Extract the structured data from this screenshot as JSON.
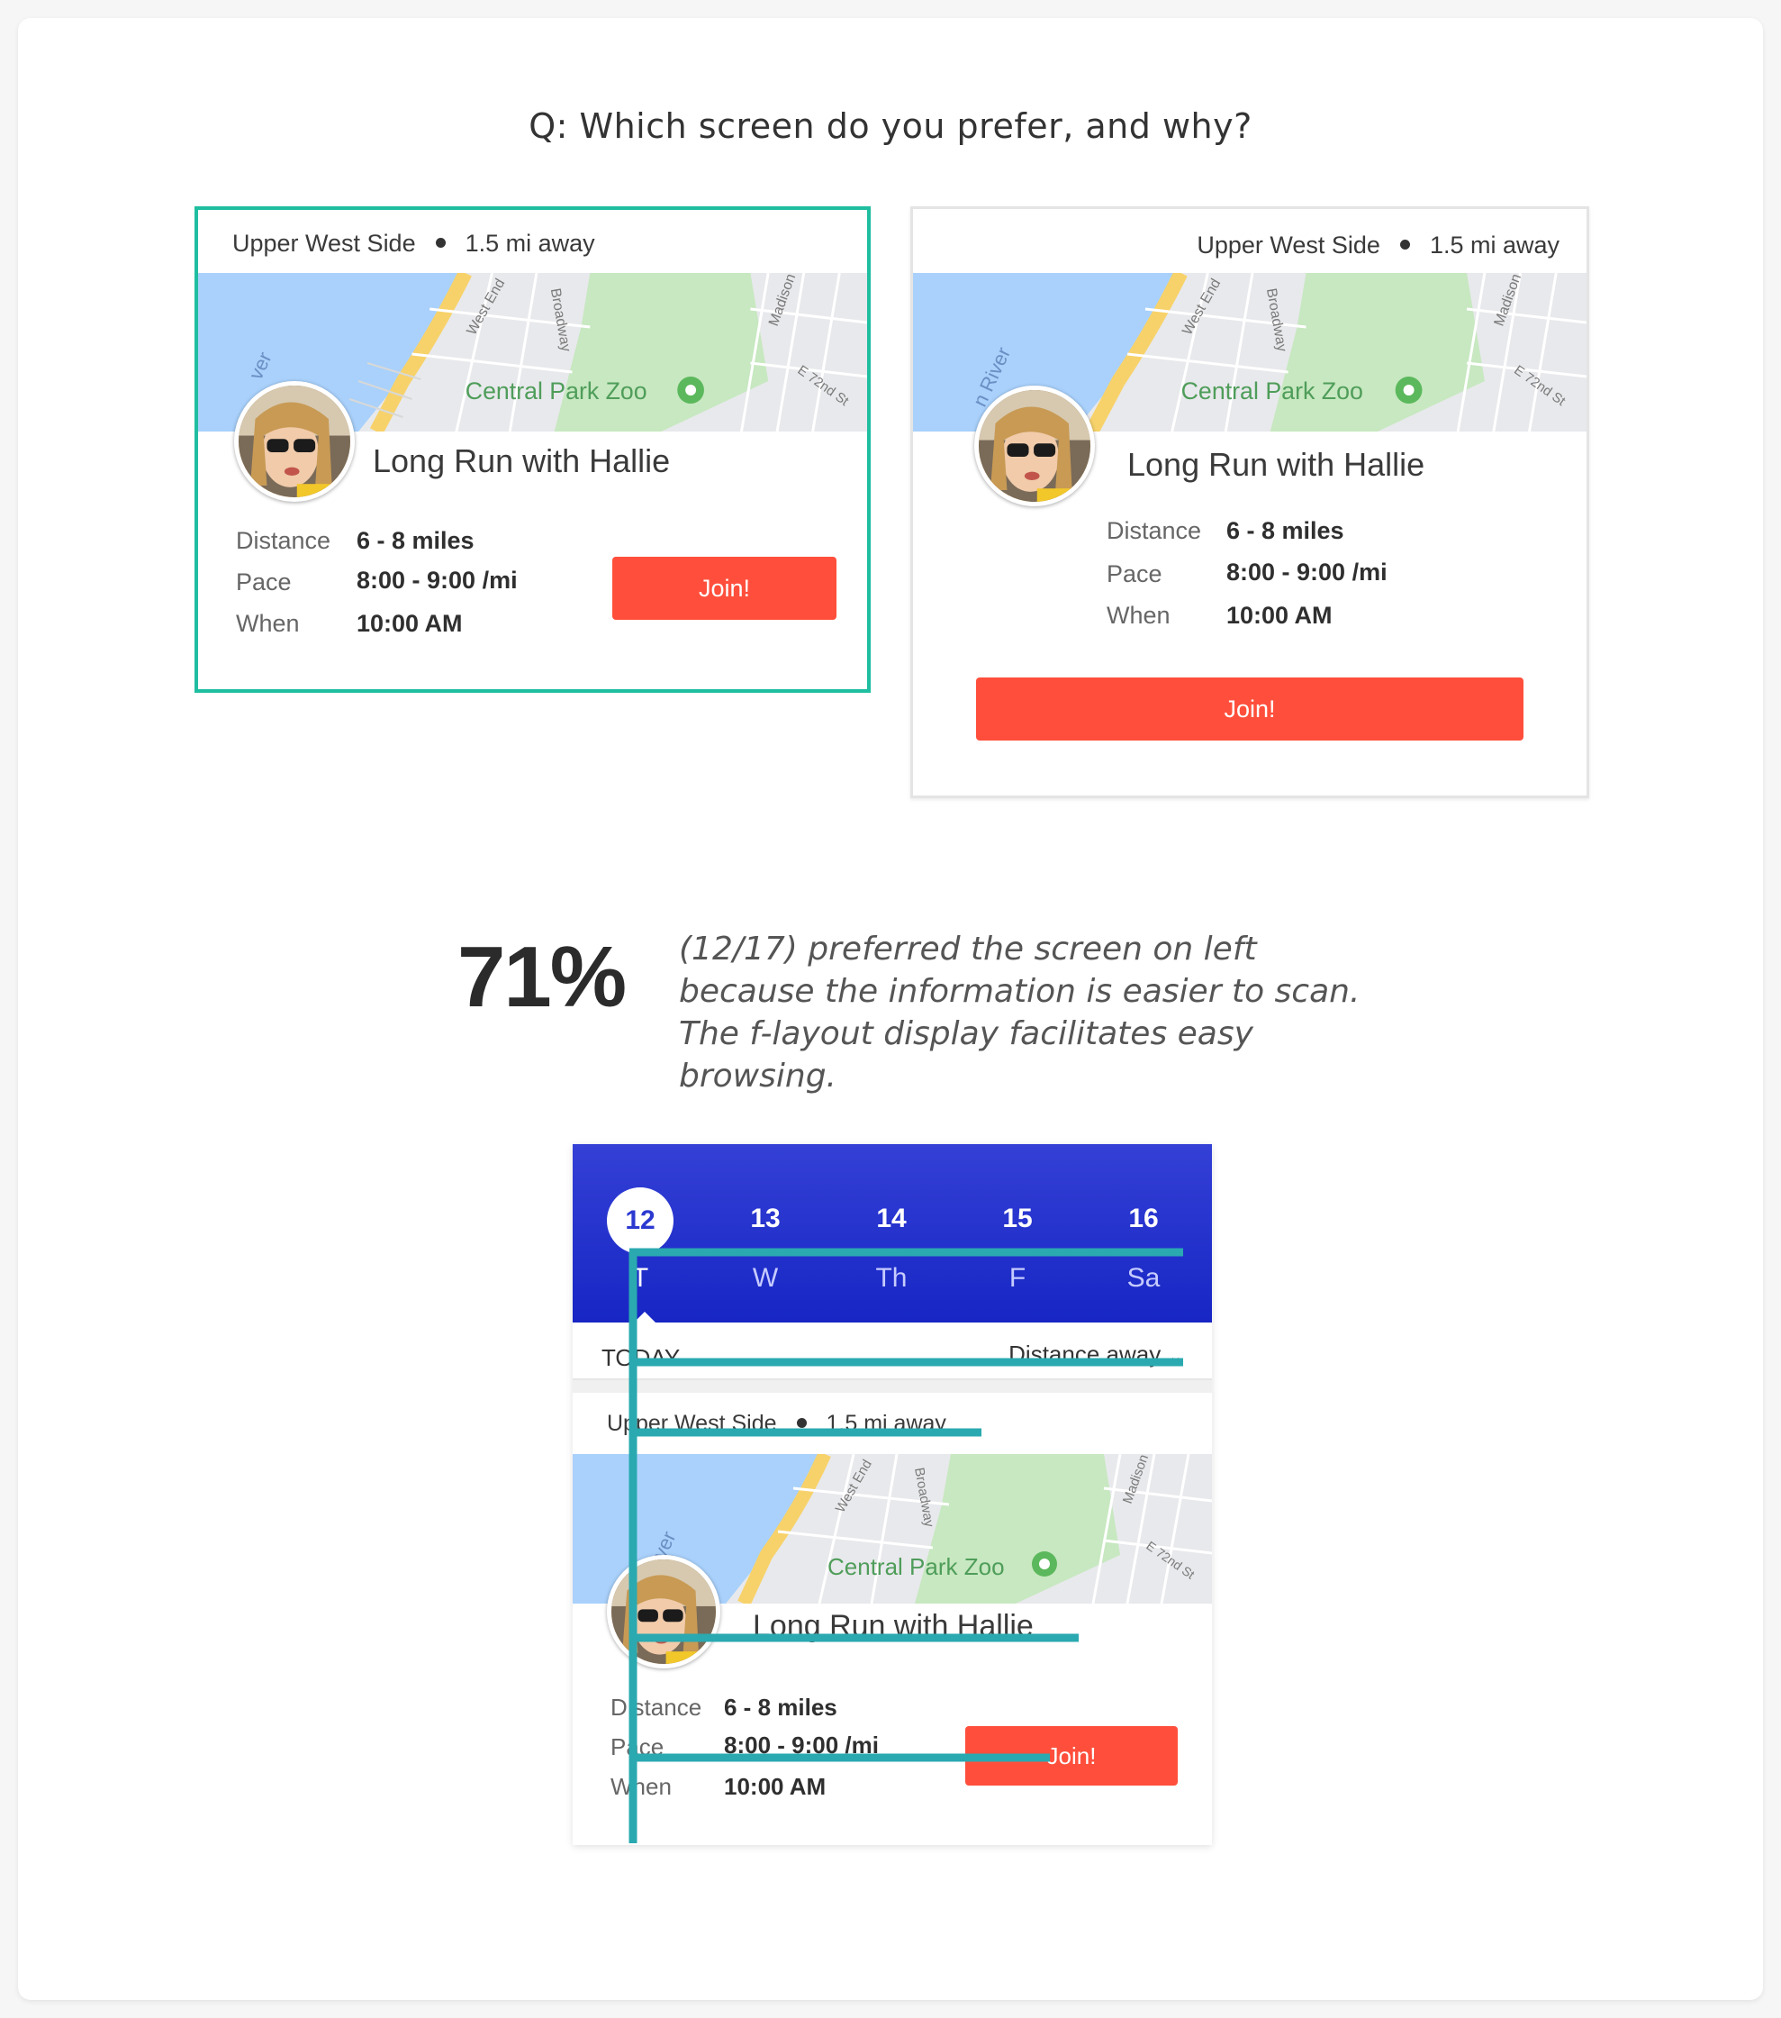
{
  "question": "Q: Which screen do you prefer, and why?",
  "variants": {
    "left": {
      "neighborhood": "Upper West Side",
      "distance_away": "1.5 mi away",
      "map_labels": {
        "park": "Central Park Zoo",
        "street1": "West End",
        "street2": "Broadway",
        "street3": "Madison",
        "street4": "E 72nd St",
        "river": "ver"
      },
      "title": "Long Run with Hallie",
      "details": [
        {
          "label": "Distance",
          "value": "6 - 8 miles"
        },
        {
          "label": "Pace",
          "value": "8:00 - 9:00 /mi"
        },
        {
          "label": "When",
          "value": "10:00 AM"
        }
      ],
      "join_label": "Join!",
      "highlight_color": "#1fbea0"
    },
    "right": {
      "neighborhood": "Upper West Side",
      "distance_away": "1.5 mi away",
      "map_labels": {
        "park": "Central Park Zoo",
        "street1": "West End",
        "street2": "Broadway",
        "street3": "Madison",
        "street4": "E 72nd St",
        "river": "n River"
      },
      "title": "Long Run with Hallie",
      "details": [
        {
          "label": "Distance",
          "value": "6 - 8 miles"
        },
        {
          "label": "Pace",
          "value": "8:00 - 9:00 /mi"
        },
        {
          "label": "When",
          "value": "10:00 AM"
        }
      ],
      "join_label": "Join!"
    }
  },
  "result": {
    "percentage": "71%",
    "explanation": "(12/17) preferred the screen on left because the information is easier to scan. The f-layout display facilitates easy browsing."
  },
  "phone": {
    "days": [
      {
        "num": "12",
        "name": "T",
        "selected": true
      },
      {
        "num": "13",
        "name": "W"
      },
      {
        "num": "14",
        "name": "Th"
      },
      {
        "num": "15",
        "name": "F"
      },
      {
        "num": "16",
        "name": "Sa"
      }
    ],
    "today_label": "TODAY",
    "sort_label": "Distance away",
    "card": {
      "neighborhood": "Upper West Side",
      "distance_away": "1.5 mi away",
      "map_labels": {
        "park": "Central Park Zoo",
        "street1": "West End",
        "street2": "Broadway",
        "street3": "Madison",
        "street4": "E 72nd St",
        "river": "ver"
      },
      "title": "Long Run with Hallie",
      "details": [
        {
          "label": "Distance",
          "value": "6 - 8 miles"
        },
        {
          "label": "Pace",
          "value": "8:00 - 9:00 /mi"
        },
        {
          "label": "When",
          "value": "10:00 AM"
        }
      ],
      "join_label": "Join!"
    },
    "overlay_color": "#2aa9b0",
    "calendar_color": "#2433cc"
  },
  "colors": {
    "join_button": "#ff4f3c",
    "map_water": "#a9d1fb",
    "map_park": "#c7e8c0",
    "map_road": "#f7d26b"
  }
}
